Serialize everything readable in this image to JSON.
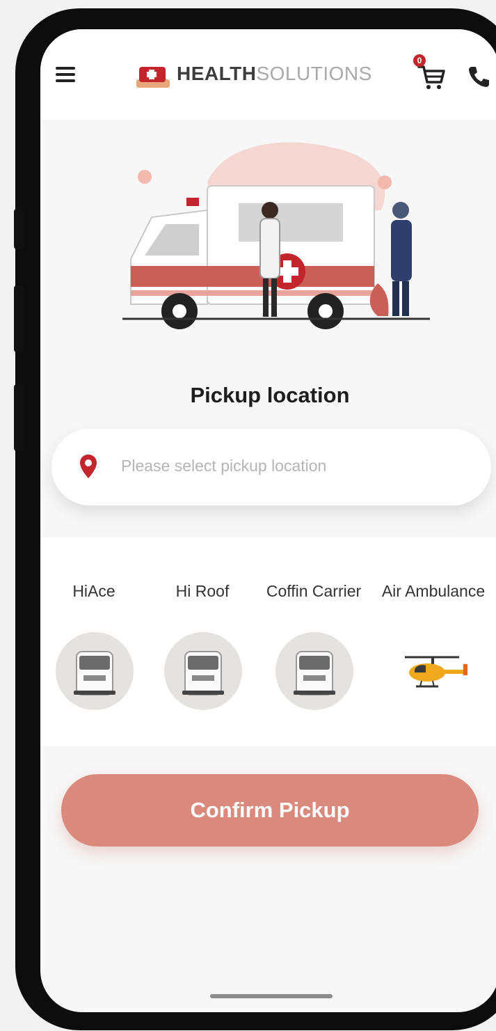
{
  "header": {
    "logo_bold": "HEALTH",
    "logo_light": "SOLUTIONS",
    "cart_count": "0"
  },
  "pickup": {
    "title": "Pickup location",
    "placeholder": "Please select pickup location"
  },
  "vehicles": [
    {
      "label": "HiAce",
      "icon": "van-icon"
    },
    {
      "label": "Hi Roof",
      "icon": "van-icon"
    },
    {
      "label": "Coffin Carrier",
      "icon": "van-icon"
    },
    {
      "label": "Air Ambulance",
      "icon": "helicopter-icon"
    }
  ],
  "actions": {
    "confirm_label": "Confirm Pickup"
  },
  "colors": {
    "accent": "#d98a7c",
    "brand_red": "#c2252b",
    "background": "#f7f7f7"
  }
}
